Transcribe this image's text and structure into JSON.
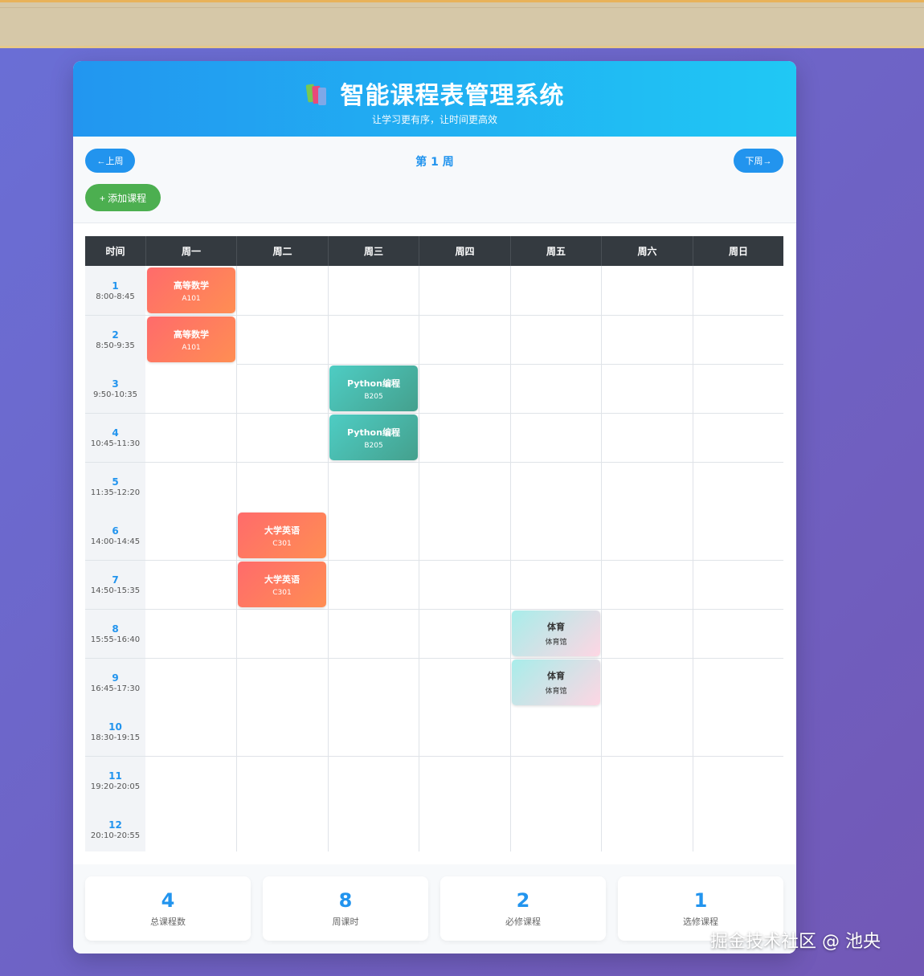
{
  "header": {
    "title": "智能课程表管理系统",
    "subtitle": "让学习更有序，让时间更高效",
    "icon": "books-icon"
  },
  "controls": {
    "prev_label": "←上周",
    "next_label": "下周→",
    "week_label": "第 1 周",
    "add_label": "+ 添加课程"
  },
  "timetable": {
    "columns": [
      "时间",
      "周一",
      "周二",
      "周三",
      "周四",
      "周五",
      "周六",
      "周日"
    ],
    "periods": [
      {
        "num": "1",
        "range": "8:00-8:45"
      },
      {
        "num": "2",
        "range": "8:50-9:35"
      },
      {
        "num": "3",
        "range": "9:50-10:35"
      },
      {
        "num": "4",
        "range": "10:45-11:30"
      },
      {
        "num": "5",
        "range": "11:35-12:20"
      },
      {
        "num": "6",
        "range": "14:00-14:45"
      },
      {
        "num": "7",
        "range": "14:50-15:35"
      },
      {
        "num": "8",
        "range": "15:55-16:40"
      },
      {
        "num": "9",
        "range": "16:45-17:30"
      },
      {
        "num": "10",
        "range": "18:30-19:15"
      },
      {
        "num": "11",
        "range": "19:20-20:05"
      },
      {
        "num": "12",
        "range": "20:10-20:55"
      }
    ],
    "courses": [
      {
        "name": "高等数学",
        "room": "A101",
        "day": "周一",
        "period": "1",
        "style": "red"
      },
      {
        "name": "高等数学",
        "room": "A101",
        "day": "周一",
        "period": "2",
        "style": "red"
      },
      {
        "name": "Python编程",
        "room": "B205",
        "day": "周三",
        "period": "3",
        "style": "green"
      },
      {
        "name": "Python编程",
        "room": "B205",
        "day": "周三",
        "period": "4",
        "style": "green"
      },
      {
        "name": "大学英语",
        "room": "C301",
        "day": "周二",
        "period": "6",
        "style": "red"
      },
      {
        "name": "大学英语",
        "room": "C301",
        "day": "周二",
        "period": "7",
        "style": "red"
      },
      {
        "name": "体育",
        "room": "体育馆",
        "day": "周五",
        "period": "8",
        "style": "pink"
      },
      {
        "name": "体育",
        "room": "体育馆",
        "day": "周五",
        "period": "9",
        "style": "pink"
      }
    ]
  },
  "stats": [
    {
      "value": "4",
      "label": "总课程数"
    },
    {
      "value": "8",
      "label": "周课时"
    },
    {
      "value": "2",
      "label": "必修课程"
    },
    {
      "value": "1",
      "label": "选修课程"
    }
  ],
  "watermark": "掘金技术社区 @ 池央",
  "colors": {
    "accent": "#2294ee",
    "header_dark": "#343a40",
    "add_green": "#4caf50"
  }
}
